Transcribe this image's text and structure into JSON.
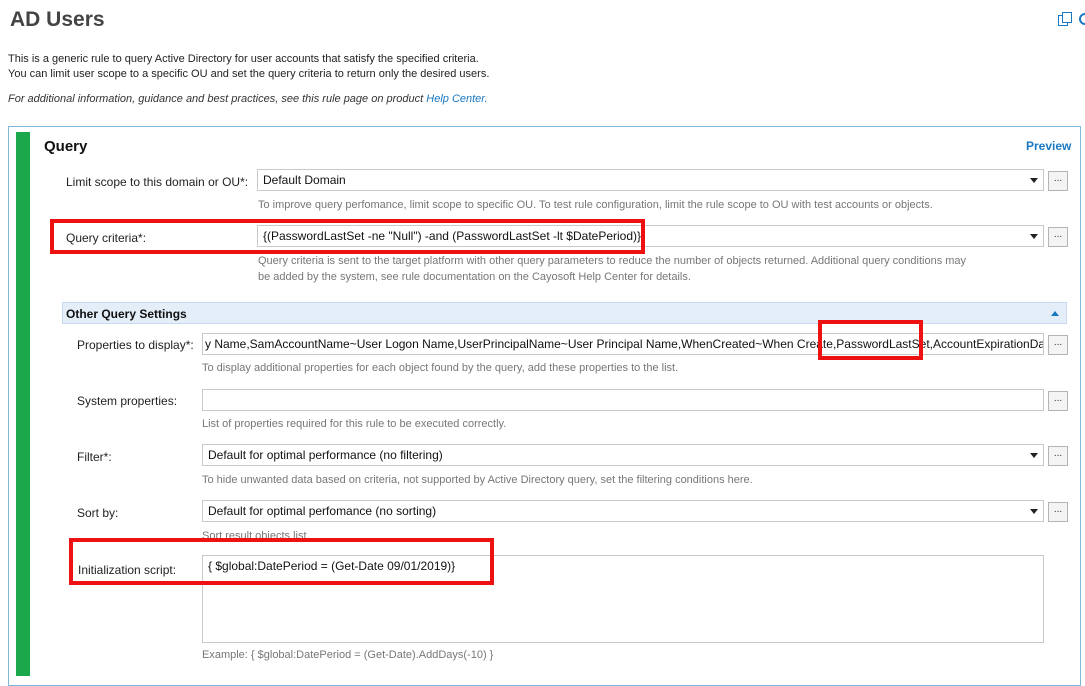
{
  "page": {
    "title": "AD Users",
    "description_line1": "This is a generic rule to query Active Directory for user accounts that satisfy the specified criteria.",
    "description_line2": "You can limit user scope to a specific OU and set the query criteria to return only the desired users.",
    "info_text": "For additional information, guidance and best practices, see this rule page on product ",
    "info_link": "Help Center."
  },
  "query": {
    "title": "Query",
    "preview_label": "Preview",
    "scope": {
      "label": "Limit scope to this domain or OU*:",
      "value": "Default Domain",
      "hint": "To improve query perfomance, limit scope to specific OU. To test rule configuration, limit the rule scope to OU with test accounts or objects."
    },
    "criteria": {
      "label": "Query criteria*:",
      "value": "{(PasswordLastSet -ne \"Null\") -and (PasswordLastSet -lt $DatePeriod)}",
      "hint_line1": "Query criteria is sent to the target platform with other query parameters to reduce the number of objects returned. Additional query conditions may",
      "hint_line2": "be added by the system, see rule documentation on the Cayosoft Help Center for details."
    },
    "browse_label": "..."
  },
  "other_settings": {
    "header": "Other Query Settings",
    "properties": {
      "label": "Properties to display*:",
      "value_before": "y Name,SamAccountName~User Logon Name,UserPrincipalName~User Principal Name,WhenCreated~When Create",
      "value_highlight": ",PasswordLastSet,",
      "value_after": "AccountExpirationDate",
      "hint": "To display additional properties for each object found by the query, add these properties to the list."
    },
    "system_properties": {
      "label": "System properties:",
      "value": "",
      "hint": "List of properties required for this rule to be executed correctly."
    },
    "filter": {
      "label": "Filter*:",
      "value": "Default for optimal performance (no filtering)",
      "hint": "To hide unwanted data based on criteria, not supported by Active Directory query, set the filtering conditions here."
    },
    "sort": {
      "label": "Sort by:",
      "value": "Default for optimal perfomance (no sorting)",
      "hint": "Sort result objects list."
    },
    "init_script": {
      "label": "Initialization script:",
      "value": "{ $global:DatePeriod = (Get-Date 09/01/2019)}",
      "hint": "Example: { $global:DatePeriod = (Get-Date).AddDays(-10) }"
    }
  },
  "colors": {
    "accent": "#1a78c2",
    "green_bar": "#1aa84a",
    "highlight_red": "#ee1111",
    "section_header_bg": "#e4eef9"
  },
  "icons": [
    "copy-icon",
    "refresh-icon",
    "dropdown-arrow-icon",
    "collapse-chevron-icon"
  ]
}
